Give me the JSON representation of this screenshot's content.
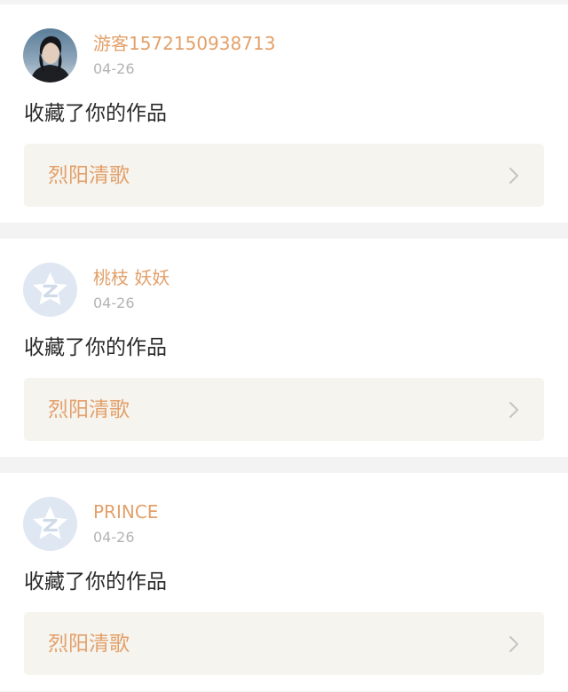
{
  "notifications": [
    {
      "username": "游客1572150938713",
      "date": "04-26",
      "action": "收藏了你的作品",
      "work_title": "烈阳清歌",
      "avatar": "photo-avatar"
    },
    {
      "username": "桃枝 妖妖",
      "date": "04-26",
      "action": "收藏了你的作品",
      "work_title": "烈阳清歌",
      "avatar": "default-z-avatar"
    },
    {
      "username": "PRINCE",
      "date": "04-26",
      "action": "收藏了你的作品",
      "work_title": "烈阳清歌",
      "avatar": "default-z-avatar"
    }
  ],
  "colors": {
    "accent": "#e3a06a",
    "date": "#b3b3b3",
    "text": "#2a2a2a",
    "link_bg": "#f5f4ef",
    "separator": "#f3f3f3",
    "default_avatar_bg": "#dfe7f2"
  },
  "icons": {
    "chevron": "chevron-right-icon",
    "default_avatar": "z-star-icon"
  }
}
